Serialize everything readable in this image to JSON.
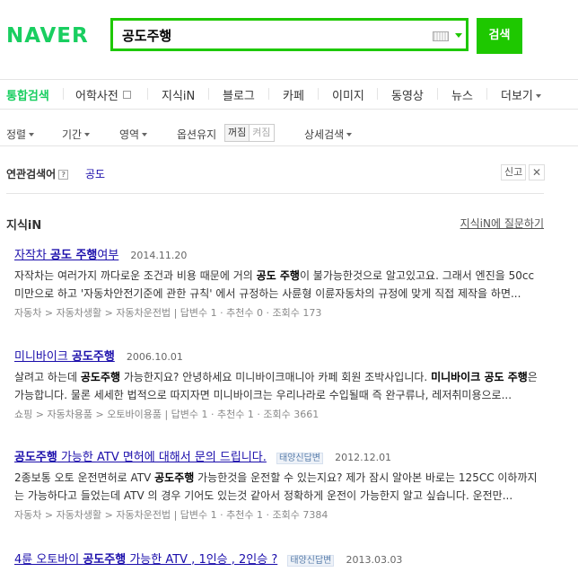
{
  "header": {
    "logo": "NAVER",
    "query": "공도주행",
    "search_button": "검색"
  },
  "tabs": [
    {
      "label": "통합검색",
      "active": true
    },
    {
      "label": "어학사전"
    },
    {
      "label": "지식iN"
    },
    {
      "label": "블로그"
    },
    {
      "label": "카페"
    },
    {
      "label": "이미지"
    },
    {
      "label": "동영상"
    },
    {
      "label": "뉴스"
    },
    {
      "label": "더보기"
    }
  ],
  "filters": {
    "sort": "정렬",
    "period": "기간",
    "area": "영역",
    "option": "옵션유지",
    "toggle_on": "꺼짐",
    "toggle_off": "켜짐",
    "detail": "상세검색"
  },
  "related": {
    "title": "연관검색어",
    "help": "?",
    "term": "공도",
    "report": "신고",
    "close": "✕"
  },
  "section": {
    "title": "지식iN",
    "ask_link": "지식iN에 질문하기"
  },
  "results": [
    {
      "title_pre": "자작차 ",
      "title_em": "공도 주행",
      "title_post": "여부",
      "date": "2014.11.20",
      "badge": "",
      "desc_pre": "자작차는 여러가지 까다로운 조건과 비용 때문에 거의 ",
      "desc_em": "공도 주행",
      "desc_em2": "",
      "desc_post": "이 불가능한것으로 알고있고요. 그래서 엔진을 50cc미만으로 하고 '자동차안전기준에 관한 규칙' 에서 규정하는 사륜형 이륜자동차의 규정에 맞게 직접 제작을 하면...",
      "meta": "자동차 > 자동차생활 > 자동차운전법 | 답변수 1 · 추천수 0 · 조회수 173"
    },
    {
      "title_pre": "미니바이크 ",
      "title_em": "공도주행",
      "title_post": "",
      "date": "2006.10.01",
      "badge": "",
      "desc_pre": "살려고 하는데 ",
      "desc_em": "공도주행",
      "desc_em2": "미니바이크 공도 주행",
      "desc_post": " 가능한지요? 안녕하세요 미니바이크매니아 카페 회원 조박사입니다. ",
      "desc_post2": "은 가능합니다. 물론 세세한 법적으로 따지자면 미니바이크는 우리나라로 수입될때 즉 완구류나, 레저취미용으로...",
      "meta": "쇼핑 > 자동차용품 > 오토바이용품 | 답변수 1 · 추천수 1 · 조회수 3661"
    },
    {
      "title_pre": "",
      "title_em": "공도주행",
      "title_post": " 가능한 ATV 면허에 대해서 문의 드립니다.",
      "date": "2012.12.01",
      "badge": "태양신답변",
      "desc_pre": "2종보통 오토 운전면허로 ATV ",
      "desc_em": "공도주행",
      "desc_em2": "",
      "desc_post": " 가능한것을 운전할 수 있는지요? 제가 잠시 알아본 바로는 125CC 이하까지는 가능하다고 들었는데 ATV 의 경우 기어도 있는것 같아서 정확하게 운전이 가능한지 알고 싶습니다. 운전만...",
      "meta": "자동차 > 자동차생활 > 자동차운전법 | 답변수 1 · 추천수 1 · 조회수 7384"
    },
    {
      "title_pre": "4륜 오토바이 ",
      "title_em": "공도주행",
      "title_post": " 가능한 ATV , 1인승 , 2인승 ?",
      "date": "2013.03.03",
      "badge": "태양신답변"
    }
  ]
}
